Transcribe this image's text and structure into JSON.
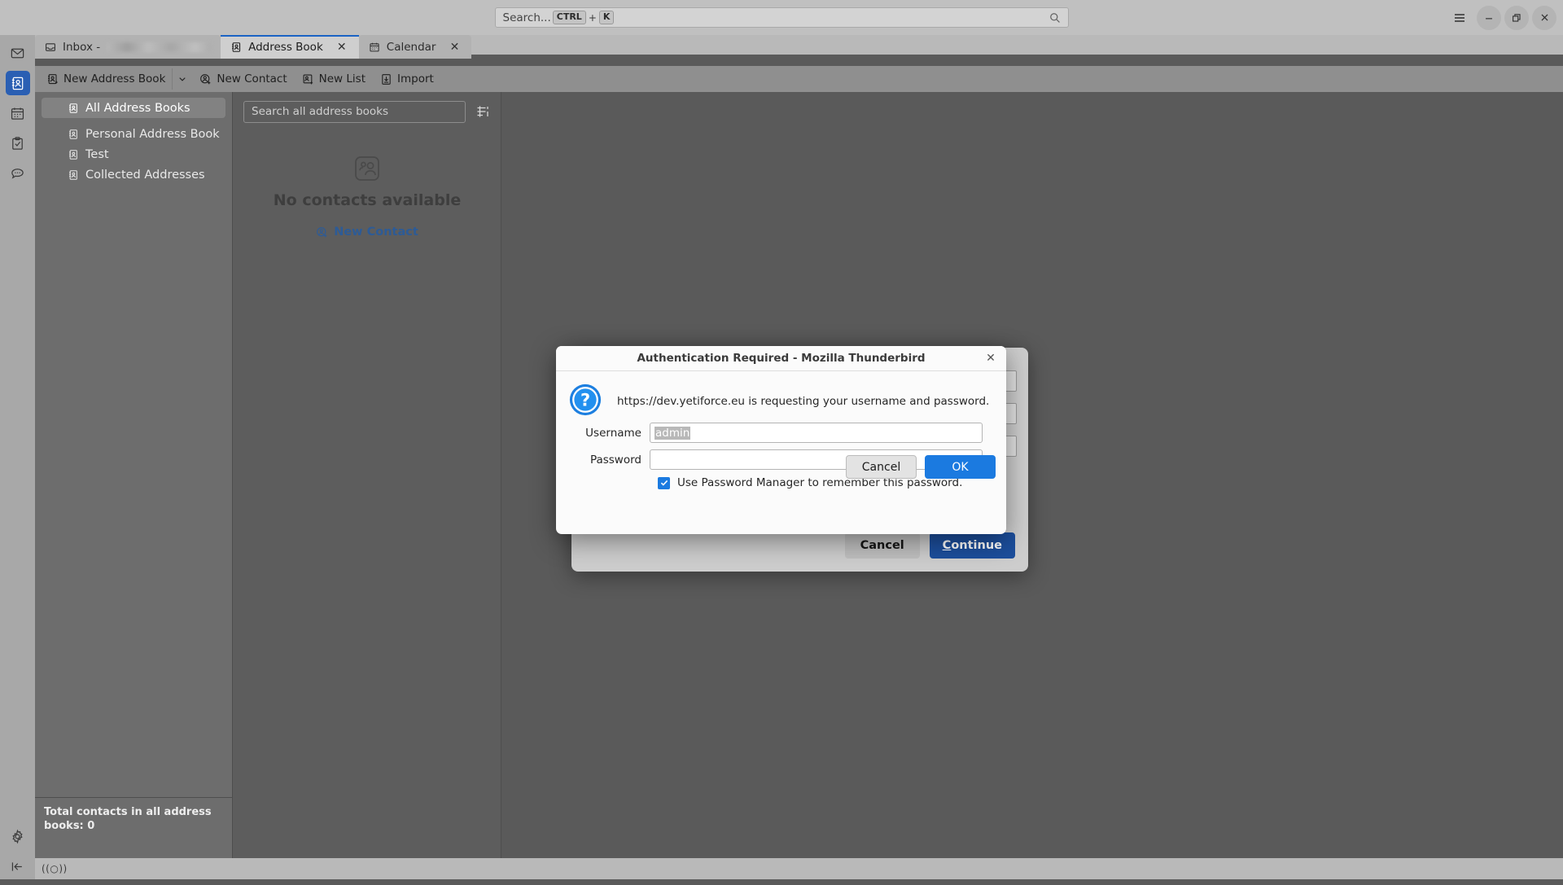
{
  "window": {
    "search": {
      "placeholder": "Search...",
      "key_modifier": "CTRL",
      "key_plus": "+",
      "key_letter": "K"
    },
    "controls": {
      "menu": "hamburger-menu",
      "minimize": "minimize",
      "restore": "restore",
      "close": "close"
    }
  },
  "rail": {
    "items": [
      {
        "name": "mail",
        "icon": "envelope-icon",
        "active": false
      },
      {
        "name": "address-book",
        "icon": "address-book-icon",
        "active": true
      },
      {
        "name": "calendar",
        "icon": "calendar-icon",
        "active": false
      },
      {
        "name": "tasks",
        "icon": "clipboard-check-icon",
        "active": false
      },
      {
        "name": "chat",
        "icon": "chat-bubble-icon",
        "active": false
      }
    ],
    "bottom": [
      {
        "name": "settings",
        "icon": "gear-icon"
      },
      {
        "name": "collapse",
        "icon": "collapse-left-icon"
      }
    ]
  },
  "tabs": [
    {
      "label": "Inbox -",
      "redacted": true,
      "icon": "inbox-icon",
      "active": false,
      "closable": false
    },
    {
      "label": "Address Book",
      "redacted": false,
      "icon": "address-book-icon",
      "active": true,
      "closable": true,
      "close_glyph": "✕"
    },
    {
      "label": "Calendar",
      "redacted": false,
      "icon": "calendar-icon",
      "active": false,
      "closable": true,
      "close_glyph": "✕"
    }
  ],
  "toolbar": {
    "new_address_book": "New Address Book",
    "new_address_book_icon": "address-book-plus-icon",
    "dropdown_glyph": "⌄",
    "new_contact": "New Contact",
    "new_contact_icon": "contact-plus-icon",
    "new_list": "New List",
    "new_list_icon": "list-plus-icon",
    "import": "Import",
    "import_icon": "import-icon"
  },
  "books_pane": {
    "items": [
      {
        "label": "All Address Books",
        "selected": true
      },
      {
        "label": "Personal Address Book",
        "selected": false
      },
      {
        "label": "Test",
        "selected": false
      },
      {
        "label": "Collected Addresses",
        "selected": false
      }
    ],
    "footer": "Total contacts in all address books: 0"
  },
  "contacts_pane": {
    "search_placeholder": "Search all address books",
    "sort_icon": "display-options-icon",
    "empty_icon": "contacts-empty-icon",
    "empty_title": "No contacts available",
    "empty_action": "New Contact",
    "empty_action_icon": "contact-plus-icon"
  },
  "statusbar": {
    "connectivity": "((○))"
  },
  "background_dialog": {
    "cancel": "Cancel",
    "continue": "Continue",
    "continue_accesskey": "C"
  },
  "auth_dialog": {
    "title": "Authentication Required - Mozilla Thunderbird",
    "close_glyph": "✕",
    "icon": "question-mark-icon",
    "message": "https://dev.yetiforce.eu is requesting your username and password.",
    "username_label": "Username",
    "username_value": "admin",
    "username_selected": true,
    "password_label": "Password",
    "password_value": "",
    "remember_label": "Use Password Manager to remember this password.",
    "remember_checked": true,
    "cancel": "Cancel",
    "ok": "OK"
  },
  "colors": {
    "accent_blue": "#1b7ae0",
    "tab_active_underline": "#1b63c4",
    "rail_active": "#2a5fb3",
    "continue_blue": "#1c4e9c",
    "link_blue": "#2d5b96"
  }
}
